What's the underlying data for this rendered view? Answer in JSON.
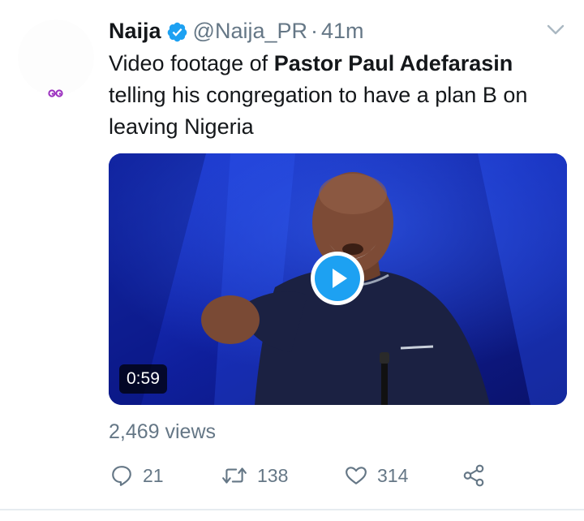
{
  "tweet": {
    "author": {
      "display_name": "Naija",
      "handle": "@Naija_PR",
      "verified": true,
      "avatar_icon": "avatar-eyes-icon"
    },
    "separator": "·",
    "time": "41m",
    "text": {
      "part1": "Video footage of ",
      "bold": "Pastor Paul Adefarasin",
      "part2": " telling his congregation to have a plan B on leaving Nigeria"
    },
    "media": {
      "type": "video",
      "duration": "0:59",
      "play_icon": "play-icon"
    },
    "views": "2,469 views",
    "actions": {
      "reply_count": "21",
      "retweet_count": "138",
      "like_count": "314",
      "share_icon": "share-icon"
    }
  },
  "colors": {
    "accent": "#1da1f2",
    "muted": "#657786",
    "text": "#14171a",
    "video_bg": "#0d1a8a"
  }
}
